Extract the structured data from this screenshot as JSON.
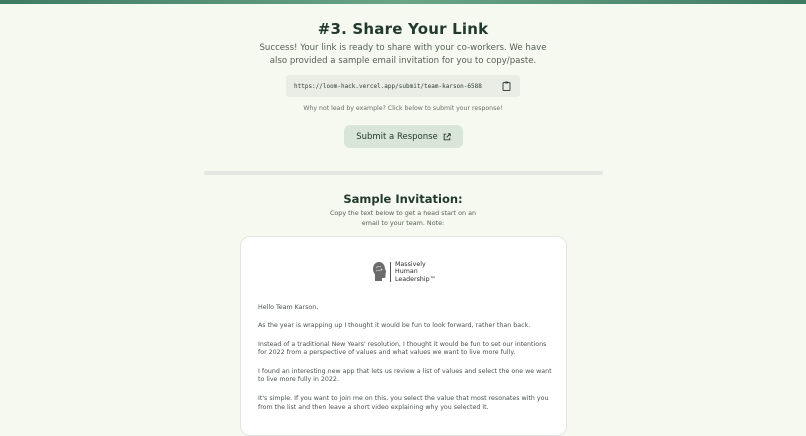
{
  "header": {
    "title": "#3. Share Your Link",
    "intro": "Success! Your link is ready to share with your co-workers. We have also provided a sample email invitation for you to copy/paste."
  },
  "link": {
    "url": "https://loom-hack.vercel.app/submit/team-karson-6588",
    "copy_icon": "clipboard-icon"
  },
  "lead": {
    "text": "Why not lead by example? Click below to submit your response!",
    "button_label": "Submit a Response",
    "button_icon": "external-link-icon"
  },
  "sample": {
    "title": "Sample Invitation:",
    "subtitle": "Copy the text below to get a head start on an email to your team. Note:"
  },
  "email": {
    "logo": {
      "line1": "Massively",
      "line2": "Human",
      "line3": "Leadership™"
    },
    "paragraphs": [
      "Hello Team Karson,",
      "As the year is wrapping up I thought it would be fun to look forward, rather than back.",
      "Instead of a traditional New Years' resolution, I thought it would be fun to set our intentions for 2022 from a perspective of values and what values we want to live more fully.",
      "I found an interesting new app that lets us review a list of values and select the one we want to live more fully in 2022.",
      "It's simple. If you want to join me on this, you select the value that most resonates with you from the list and then leave a short video explaining why you selected it."
    ]
  },
  "colors": {
    "background": "#f6f9ef",
    "accent": "#3f7a63",
    "button": "#d9e5d8"
  }
}
